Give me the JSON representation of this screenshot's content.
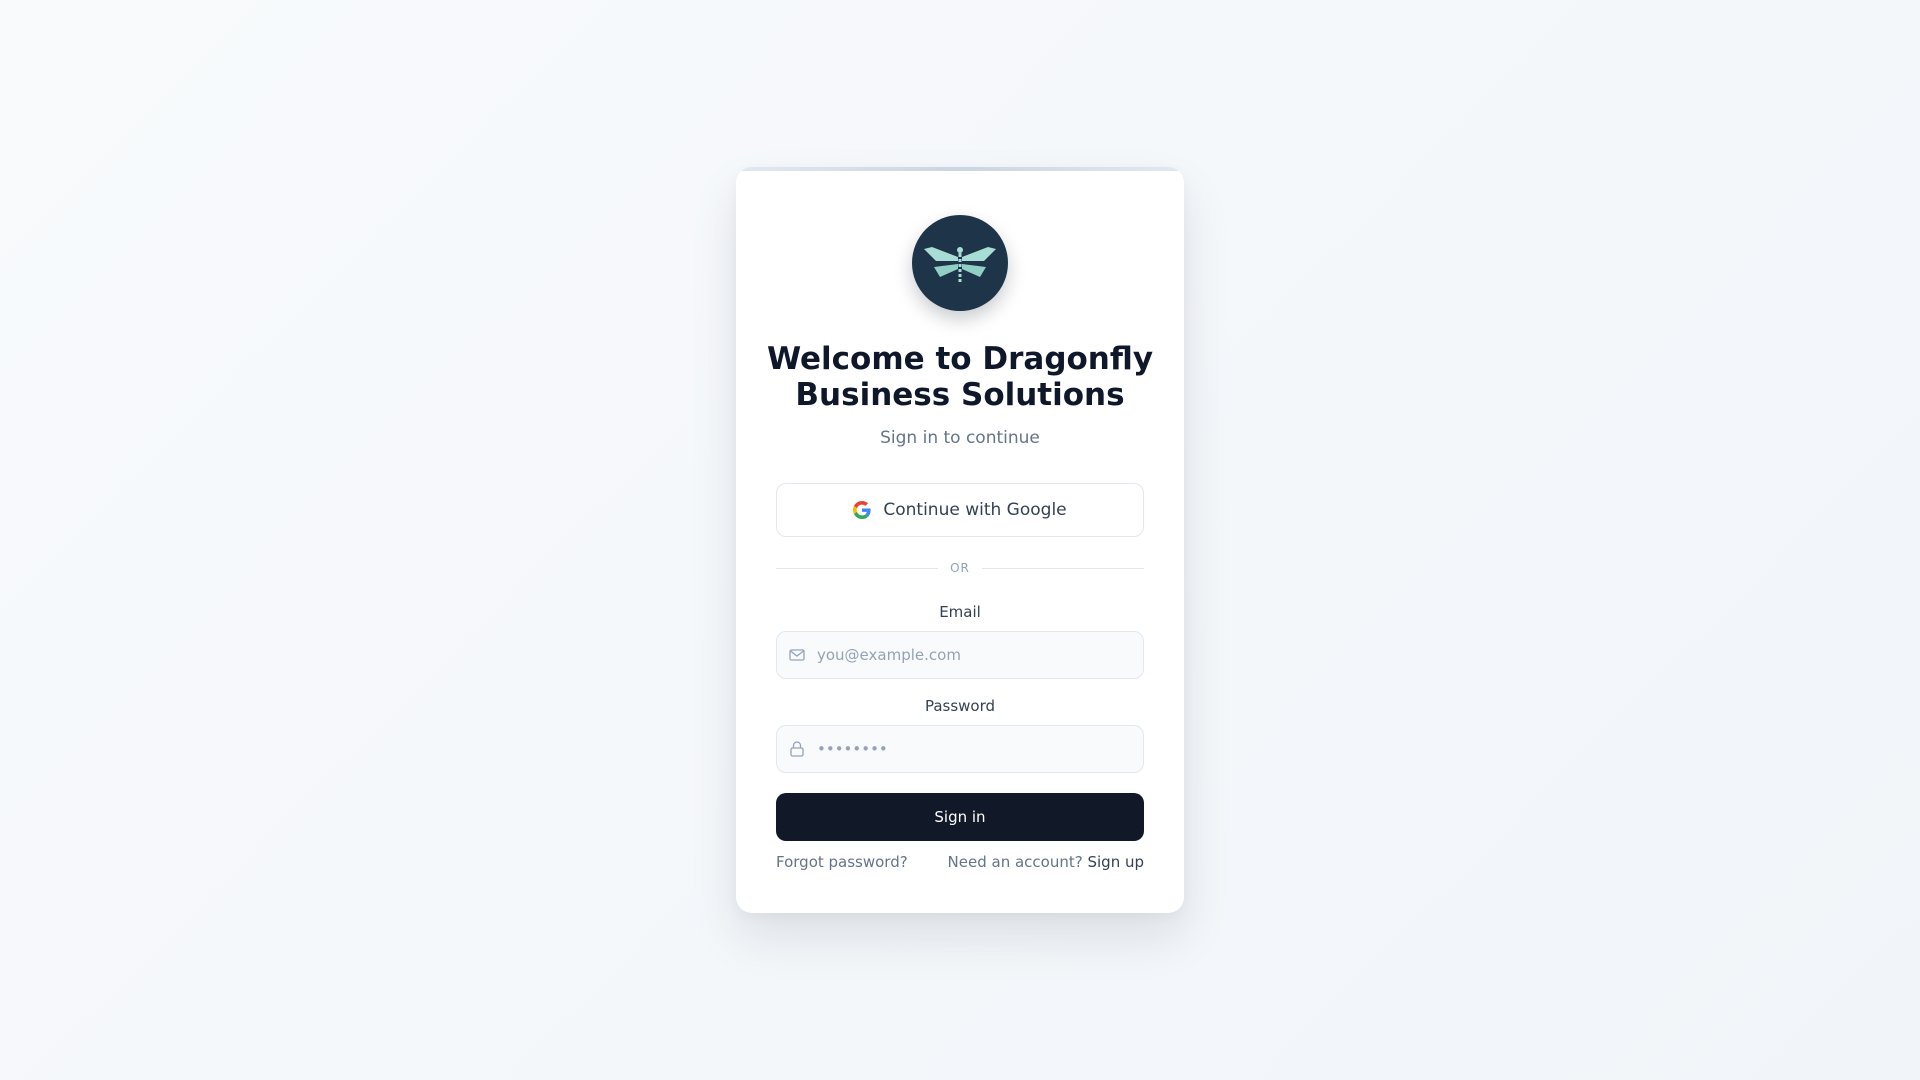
{
  "brand": {
    "logo_icon": "dragonfly-icon",
    "title": "Welcome to Dragonfly Business Solutions",
    "subtitle": "Sign in to continue"
  },
  "google": {
    "icon": "google-icon",
    "label": "Continue with Google"
  },
  "divider": {
    "text": "OR"
  },
  "email": {
    "label": "Email",
    "icon": "mail-icon",
    "placeholder": "you@example.com",
    "value": ""
  },
  "password": {
    "label": "Password",
    "icon": "lock-icon",
    "placeholder": "••••••••",
    "value": ""
  },
  "signin": {
    "label": "Sign in"
  },
  "footer": {
    "forgot": "Forgot password?",
    "need_account": "Need an account?",
    "signup": "Sign up"
  },
  "colors": {
    "logo_bg": "#1e3448",
    "logo_wings": "#a7ddd4",
    "primary_button": "#111827",
    "background": "#f5f8fa"
  }
}
